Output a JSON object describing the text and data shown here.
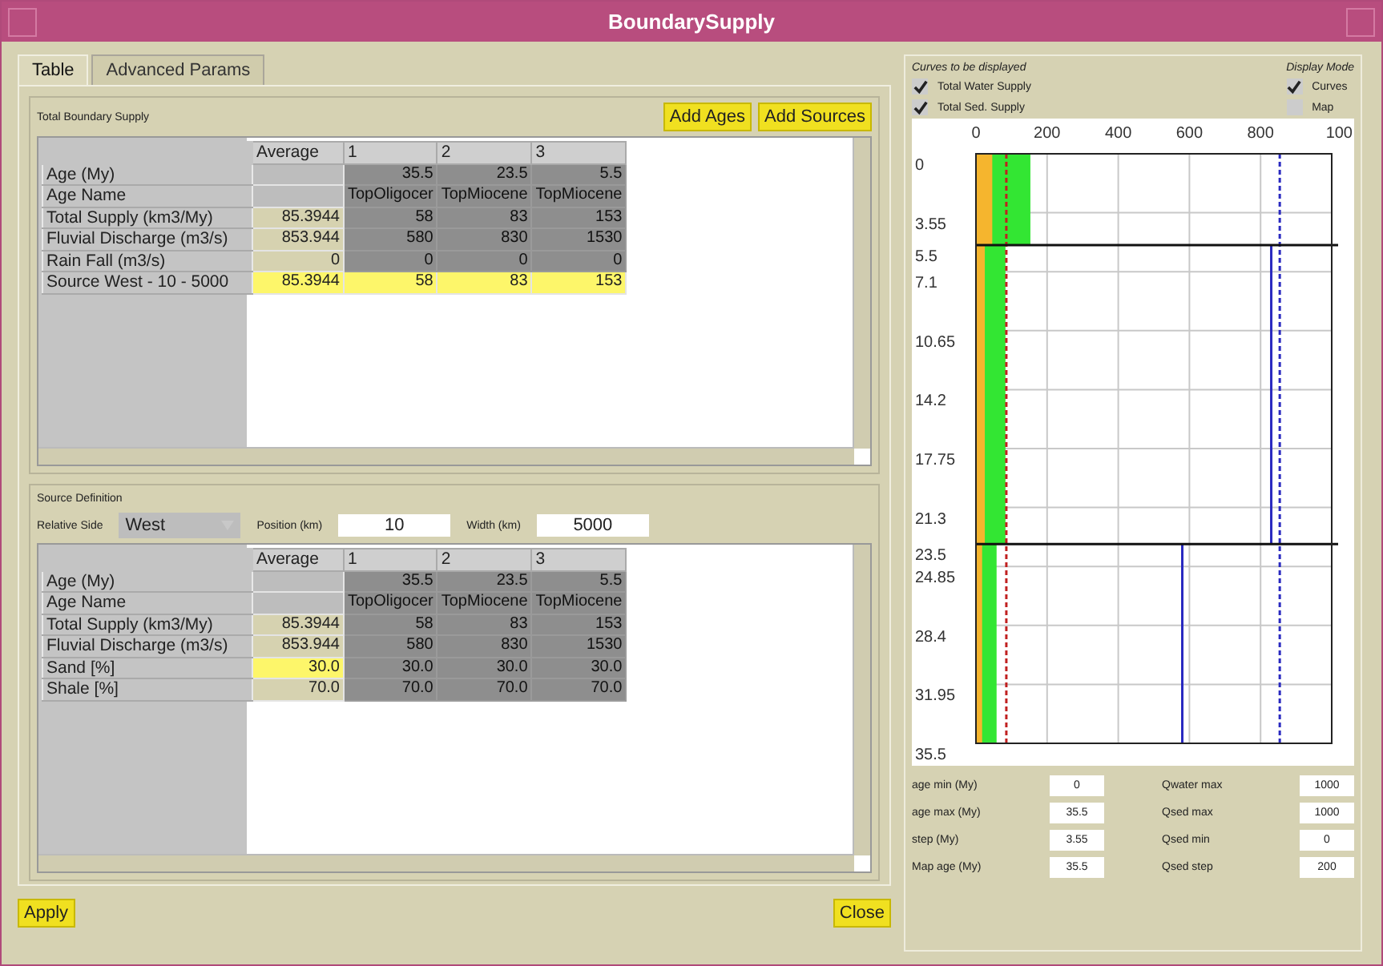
{
  "window": {
    "title": "BoundarySupply"
  },
  "tabs": [
    {
      "label": "Table",
      "selected": true
    },
    {
      "label": "Advanced Params",
      "selected": false
    }
  ],
  "total_supply": {
    "title": "Total Boundary Supply",
    "buttons": [
      "Add Ages",
      "Add Sources"
    ],
    "columns": [
      "Average",
      "1",
      "2",
      "3"
    ],
    "rows": [
      {
        "label": "Age (My)",
        "cells": [
          {
            "highlight": false
          },
          {
            "text": "35.5",
            "highlight": false
          },
          {
            "text": "23.5",
            "highlight": false
          },
          {
            "text": "5.5",
            "highlight": false
          }
        ]
      },
      {
        "label": "Age Name",
        "cells": [
          {
            "highlight": false
          },
          {
            "text": "TopOligocer",
            "highlight": false
          },
          {
            "text": "TopMiocene",
            "highlight": false
          },
          {
            "text": "TopMiocene",
            "highlight": false
          }
        ]
      },
      {
        "label": "Total Supply (km3/My)",
        "cells": [
          {
            "text": "85.3944",
            "highlight": false
          },
          {
            "text": "58",
            "highlight": false
          },
          {
            "text": "83",
            "highlight": false
          },
          {
            "text": "153",
            "highlight": false
          }
        ]
      },
      {
        "label": "Fluvial Discharge (m3/s)",
        "cells": [
          {
            "text": "853.944",
            "highlight": false
          },
          {
            "text": "580",
            "highlight": false
          },
          {
            "text": "830",
            "highlight": false
          },
          {
            "text": "1530",
            "highlight": false
          }
        ]
      },
      {
        "label": "Rain Fall (m3/s)",
        "cells": [
          {
            "text": "0",
            "highlight": false
          },
          {
            "text": "0",
            "highlight": false
          },
          {
            "text": "0",
            "highlight": false
          },
          {
            "text": "0",
            "highlight": false
          }
        ]
      },
      {
        "label": "Source West - 10 - 5000",
        "cells": [
          {
            "text": "85.3944",
            "highlight": true
          },
          {
            "text": "58",
            "highlight": true
          },
          {
            "text": "83",
            "highlight": true
          },
          {
            "text": "153",
            "highlight": true
          }
        ]
      }
    ]
  },
  "source_definition": {
    "title": "Source Definition",
    "side_label": "Relative Side",
    "side_value": "West",
    "position_label": "Position (km)",
    "position_value": "10",
    "width_label": "Width (km)",
    "width_value": "5000",
    "columns": [
      "Average",
      "1",
      "2",
      "3"
    ],
    "rows": [
      {
        "label": "Age (My)",
        "cells": [
          {
            "highlight": false
          },
          {
            "text": "35.5",
            "highlight": false
          },
          {
            "text": "23.5",
            "highlight": false
          },
          {
            "text": "5.5",
            "highlight": false
          }
        ]
      },
      {
        "label": "Age Name",
        "cells": [
          {
            "highlight": false
          },
          {
            "text": "TopOligocer",
            "highlight": false
          },
          {
            "text": "TopMiocene",
            "highlight": false
          },
          {
            "text": "TopMiocene",
            "highlight": false
          }
        ]
      },
      {
        "label": "Total Supply (km3/My)",
        "cells": [
          {
            "text": "85.3944",
            "highlight": false
          },
          {
            "text": "58",
            "highlight": false
          },
          {
            "text": "83",
            "highlight": false
          },
          {
            "text": "153",
            "highlight": false
          }
        ]
      },
      {
        "label": "Fluvial Discharge (m3/s)",
        "cells": [
          {
            "text": "853.944",
            "highlight": false
          },
          {
            "text": "580",
            "highlight": false
          },
          {
            "text": "830",
            "highlight": false
          },
          {
            "text": "1530",
            "highlight": false
          }
        ]
      },
      {
        "label": "Sand [%]",
        "cells": [
          {
            "text": "30.0",
            "highlight": true
          },
          {
            "text": "30.0",
            "highlight": false
          },
          {
            "text": "30.0",
            "highlight": false
          },
          {
            "text": "30.0",
            "highlight": false
          }
        ]
      },
      {
        "label": "Shale [%]",
        "cells": [
          {
            "text": "70.0",
            "highlight": false
          },
          {
            "text": "70.0",
            "highlight": false
          },
          {
            "text": "70.0",
            "highlight": false
          },
          {
            "text": "70.0",
            "highlight": false
          }
        ]
      }
    ]
  },
  "footer_buttons": [
    "Apply",
    "Close"
  ],
  "curves": {
    "title": "Curves to be displayed",
    "items": [
      {
        "label": "Total Water Supply",
        "checked": true
      },
      {
        "label": "Total Sed. Supply",
        "checked": true
      }
    ]
  },
  "display_mode": {
    "title": "Display Mode",
    "items": [
      {
        "label": "Curves",
        "checked": true
      },
      {
        "label": "Map",
        "checked": false
      }
    ]
  },
  "plot": {
    "x_axis_labels": [
      "0",
      "200",
      "400",
      "600",
      "800",
      "100"
    ],
    "y_axis_labels": [
      "0",
      "3.55",
      "5.5",
      "7.1",
      "10.65",
      "14.2",
      "17.75",
      "21.3",
      "23.5",
      "24.85",
      "28.4",
      "31.95",
      "35.5"
    ]
  },
  "fields_left": [
    {
      "label": "age min (My)",
      "value": "0"
    },
    {
      "label": "age max (My)",
      "value": "35.5"
    },
    {
      "label": "step (My)",
      "value": "3.55"
    },
    {
      "label": "Map age (My)",
      "value": "35.5"
    }
  ],
  "fields_right": [
    {
      "label": "Qwater max",
      "value": "1000"
    },
    {
      "label": "Qsed max",
      "value": "1000"
    },
    {
      "label": "Qsed min",
      "value": "0"
    },
    {
      "label": "Qsed step",
      "value": "200"
    }
  ]
}
